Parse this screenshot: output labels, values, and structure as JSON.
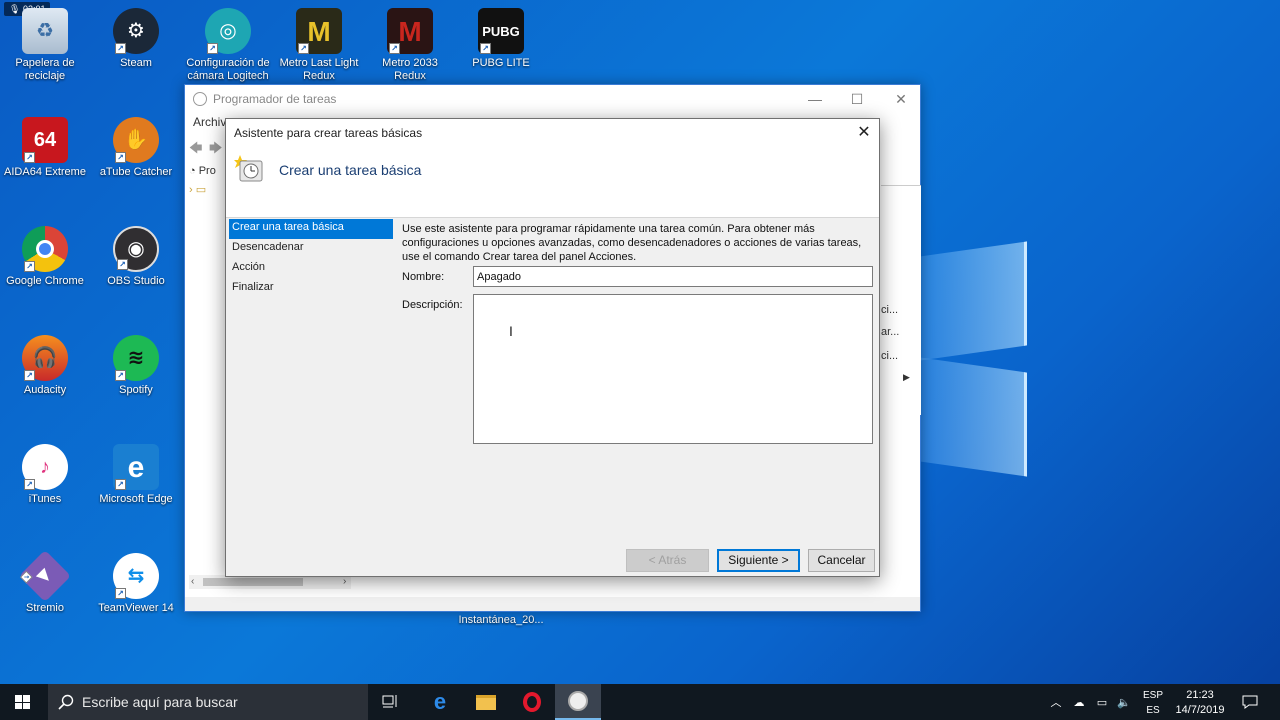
{
  "recording": {
    "time": "02:01"
  },
  "desktop": {
    "icons": [
      {
        "label": "Papelera de reciclaje",
        "icon": "recycle-bin-icon"
      },
      {
        "label": "Steam",
        "icon": "steam-icon"
      },
      {
        "label": "Configuración de cámara Logitech",
        "icon": "logitech-camera-icon"
      },
      {
        "label": "Metro Last Light Redux",
        "icon": "metro-last-light-icon"
      },
      {
        "label": "Metro 2033 Redux",
        "icon": "metro-2033-icon"
      },
      {
        "label": "PUBG LITE",
        "icon": "pubg-lite-icon"
      },
      {
        "label": "AIDA64 Extreme",
        "icon": "aida64-icon"
      },
      {
        "label": "aTube Catcher",
        "icon": "atube-catcher-icon"
      },
      {
        "label": "Google Chrome",
        "icon": "chrome-icon"
      },
      {
        "label": "OBS Studio",
        "icon": "obs-icon"
      },
      {
        "label": "Audacity",
        "icon": "audacity-icon"
      },
      {
        "label": "Spotify",
        "icon": "spotify-icon"
      },
      {
        "label": "iTunes",
        "icon": "itunes-icon"
      },
      {
        "label": "Microsoft Edge",
        "icon": "edge-icon"
      },
      {
        "label": "Stremio",
        "icon": "stremio-icon"
      },
      {
        "label": "TeamViewer 14",
        "icon": "teamviewer-icon"
      }
    ],
    "screenshot_label": "Instantánea_20..."
  },
  "bg_window": {
    "title": "Programador de tareas",
    "menu_first": "Archivo",
    "tree_root": "Pro",
    "right_items": [
      "ci...",
      "ar...",
      "ci..."
    ]
  },
  "wizard": {
    "title": "Asistente para crear tareas básicas",
    "heading": "Crear una tarea básica",
    "steps": [
      "Crear una tarea básica",
      "Desencadenar",
      "Acción",
      "Finalizar"
    ],
    "active_step": 0,
    "intro": "Use este asistente para programar rápidamente una tarea común. Para obtener más configuraciones u opciones avanzadas, como desencadenadores o acciones de varias tareas, use el comando Crear tarea del panel Acciones.",
    "name_label": "Nombre:",
    "name_value": "Apagado",
    "description_label": "Descripción:",
    "description_value": "",
    "buttons": {
      "back": "< Atrás",
      "next": "Siguiente >",
      "cancel": "Cancelar"
    }
  },
  "taskbar": {
    "search_placeholder": "Escribe aquí para buscar",
    "language": "ESP",
    "layout": "ES",
    "time": "21:23",
    "date": "14/7/2019"
  },
  "colors": {
    "accent": "#0078d7",
    "taskbar": "#101820",
    "desktop": "#0b78d8"
  }
}
